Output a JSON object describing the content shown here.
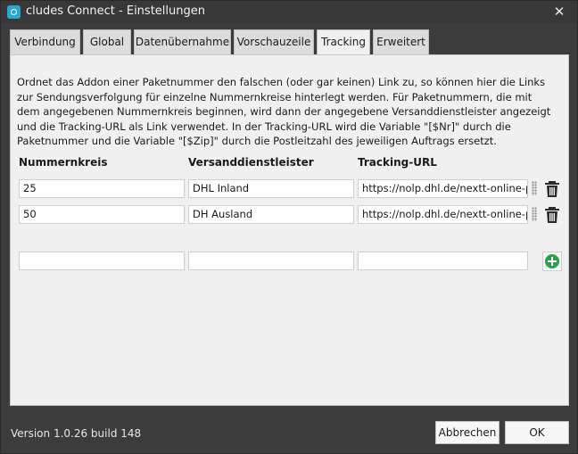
{
  "window": {
    "title": "cludes Connect - Einstellungen",
    "close_symbol": "✕"
  },
  "tabs": [
    {
      "label": "Verbindung",
      "active": false
    },
    {
      "label": "Global",
      "active": false
    },
    {
      "label": "Datenübernahme",
      "active": false
    },
    {
      "label": "Vorschauzeile",
      "active": false
    },
    {
      "label": "Tracking",
      "active": true
    },
    {
      "label": "Erweitert",
      "active": false
    }
  ],
  "tracking": {
    "description": "Ordnet das Addon einer Paketnummer den falschen (oder gar keinen) Link zu, so können hier die Links zur Sendungsverfolgung für einzelne Nummernkreise hinterlegt werden. Für Paketnummern, die mit dem angegebenen Nummernkreis beginnen, wird dann der angegebene Versanddienstleister angezeigt und die Tracking-URL als Link verwendet. In der Tracking-URL wird die Variable \"[$Nr]\" durch die Paketnummer und die Variable \"[$Zip]\" durch die Postleitzahl des jeweiligen Auftrags ersetzt.",
    "columns": {
      "range": "Nummernkreis",
      "carrier": "Versanddienstleister",
      "url": "Tracking-URL"
    },
    "rows": [
      {
        "range": "25",
        "carrier": "DHL Inland",
        "url": "https://nolp.dhl.de/nextt-online-pu"
      },
      {
        "range": "50",
        "carrier": "DH Ausland",
        "url": "https://nolp.dhl.de/nextt-online-pu"
      }
    ],
    "new_row": {
      "range": "",
      "carrier": "",
      "url": ""
    }
  },
  "footer": {
    "version": "Version 1.0.26 build 148",
    "cancel_label": "Abbrechen",
    "ok_label": "OK"
  },
  "icons": {
    "delete": "trash-icon",
    "add": "plus-circle-icon",
    "drag": "drag-handle-icon"
  },
  "colors": {
    "add_green": "#2e9e4f",
    "app_blue": "#29a6d8",
    "chrome_dark": "#3c3c3c"
  }
}
